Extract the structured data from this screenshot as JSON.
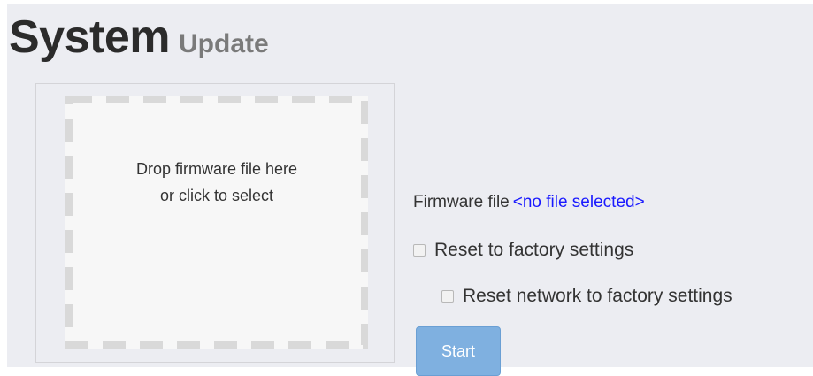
{
  "header": {
    "title": "System",
    "subtitle": "Update"
  },
  "dropzone": {
    "line1": "Drop firmware file here",
    "line2": "or click to select"
  },
  "firmware": {
    "label": "Firmware file",
    "value": "<no file selected>"
  },
  "options": {
    "reset_factory": {
      "label": "Reset to factory settings",
      "checked": false
    },
    "reset_network": {
      "label": "Reset network to factory settings",
      "checked": false
    }
  },
  "actions": {
    "start_label": "Start"
  },
  "colors": {
    "background": "#ecedf2",
    "accent": "#7fb0e0",
    "link": "#1a1aff"
  }
}
